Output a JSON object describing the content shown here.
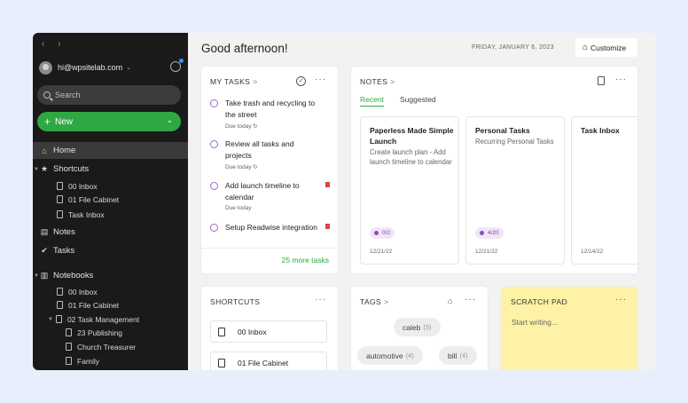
{
  "sidebar": {
    "nav_arrows": "‹ ›",
    "account_email": "hi@wpsitelab.com",
    "account_caret": "⌄",
    "search_placeholder": "Search",
    "new_label": "New",
    "new_chevron": "⌄",
    "home": "Home",
    "shortcuts": "Shortcuts",
    "shortcut_items": [
      "00 Inbox",
      "01 File Cabinet",
      "Task Inbox"
    ],
    "notes": "Notes",
    "tasks": "Tasks",
    "notebooks": "Notebooks",
    "notebook_items": [
      "00 Inbox",
      "01 File Cabinet",
      "02 Task Management",
      "23 Publishing",
      "Church Treasurer",
      "Family"
    ]
  },
  "header": {
    "greeting": "Good afternoon!",
    "date": "FRIDAY, JANUARY 6, 2023",
    "customize_label": "Customize"
  },
  "tasks_card": {
    "title": "MY TASKS",
    "arrow": ">",
    "more": "···",
    "tasks": [
      {
        "text": "Take trash and recycling to the street",
        "due": "Due today ↻"
      },
      {
        "text": "Review all tasks and projects",
        "due": "Due today ↻"
      },
      {
        "text": "Add launch timeline to calendar",
        "due": "Due today"
      },
      {
        "text": "Setup Readwise integration",
        "due": ""
      }
    ],
    "more_tasks": "25 more tasks"
  },
  "notes_card": {
    "title": "NOTES",
    "arrow": ">",
    "more": "···",
    "tabs": [
      "Recent",
      "Suggested"
    ],
    "notes": [
      {
        "title": "Paperless Made Simple Launch",
        "body": "Create launch plan - Add launch timeline to calendar",
        "badge": "0/2",
        "date": "12/21/22"
      },
      {
        "title": "Personal Tasks",
        "body": "Recurring Personal Tasks",
        "badge": "4/20",
        "date": "12/21/22"
      },
      {
        "title": "Task Inbox",
        "body": "",
        "badge": "",
        "date": "12/14/22"
      }
    ]
  },
  "shortcuts_card": {
    "title": "SHORTCUTS",
    "more": "···",
    "items": [
      "00 Inbox",
      "01 File Cabinet"
    ]
  },
  "tags_card": {
    "title": "TAGS",
    "arrow": ">",
    "more": "···",
    "tags": [
      {
        "name": "caleb",
        "count": "(5)"
      },
      {
        "name": "automotive",
        "count": "(4)"
      },
      {
        "name": "bill",
        "count": "(4)"
      }
    ]
  },
  "scratch_card": {
    "title": "SCRATCH PAD",
    "more": "···",
    "placeholder": "Start writing..."
  },
  "colors": {
    "accent_green": "#2fa844",
    "task_circle": "#9a6cc4",
    "flag_red": "#d9473f",
    "scratch_yellow": "#fdf2a6"
  }
}
